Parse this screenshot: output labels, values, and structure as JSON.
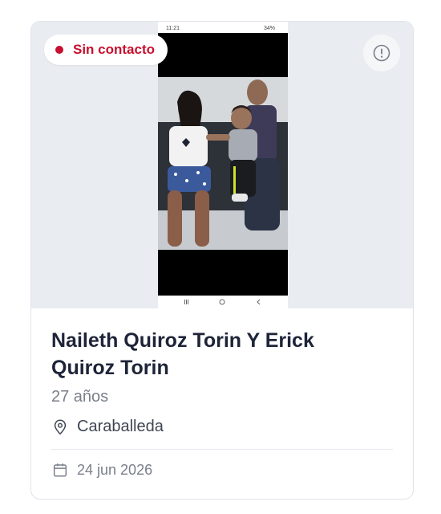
{
  "status": {
    "label": "Sin contacto",
    "color": "#c8102e"
  },
  "info_button": {
    "icon": "alert-circle-icon"
  },
  "photo": {
    "status_time": "11:21",
    "status_battery": "34%",
    "nav_icons": [
      "recent-apps-icon",
      "home-icon",
      "back-icon"
    ]
  },
  "person": {
    "name": "Naileth Quiroz Torin Y Erick Quiroz Torin",
    "age": "27 años",
    "location": "Caraballeda",
    "date": "24 jun 2026"
  }
}
